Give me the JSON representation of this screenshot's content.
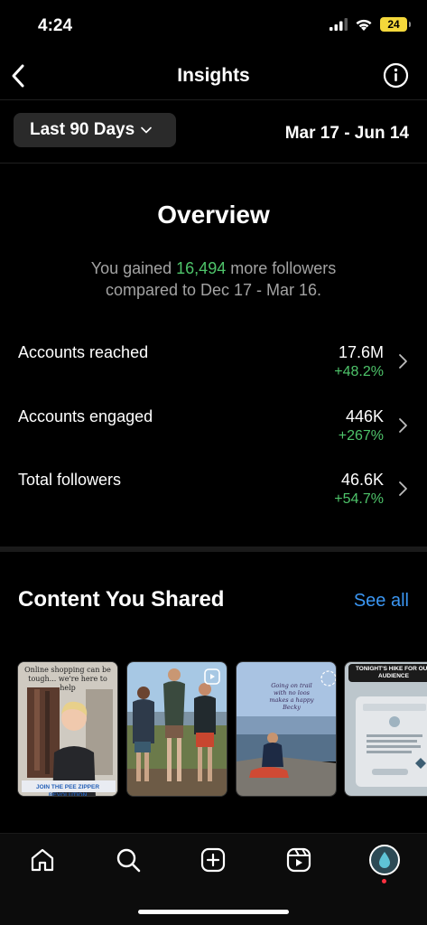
{
  "status": {
    "time": "4:24",
    "battery": "24"
  },
  "nav": {
    "title": "Insights"
  },
  "range": {
    "label": "Last 90 Days",
    "dates": "Mar 17 - Jun 14"
  },
  "overview": {
    "title": "Overview",
    "prefix": "You gained ",
    "gained": "16,494",
    "suffix": " more followers",
    "line2": "compared to Dec 17 - Mar 16."
  },
  "metrics": [
    {
      "label": "Accounts reached",
      "value": "17.6M",
      "change": "+48.2%"
    },
    {
      "label": "Accounts engaged",
      "value": "446K",
      "change": "+267%"
    },
    {
      "label": "Total followers",
      "value": "46.6K",
      "change": "+54.7%"
    }
  ],
  "content": {
    "title": "Content You Shared",
    "see_all": "See all",
    "thumbs": [
      {
        "caption_top": "Online shopping can be tough... we're here to help",
        "caption_bottom": "JOIN THE PEE ZIPPER REVOLUTION"
      },
      {
        "caption_top": "",
        "caption_bottom": ""
      },
      {
        "caption_top": "Going on trail with no loos makes a happy Becky",
        "caption_bottom": ""
      },
      {
        "caption_top": "TONIGHT'S HIKE FOR OUR AUDIENCE",
        "caption_bottom": ""
      }
    ]
  },
  "tabs": [
    "home-icon",
    "search-icon",
    "create-icon",
    "reels-icon",
    "profile-icon"
  ],
  "colors": {
    "accent": "#3b96f2",
    "positive": "#4ec46a",
    "battery": "#f4d83b"
  }
}
